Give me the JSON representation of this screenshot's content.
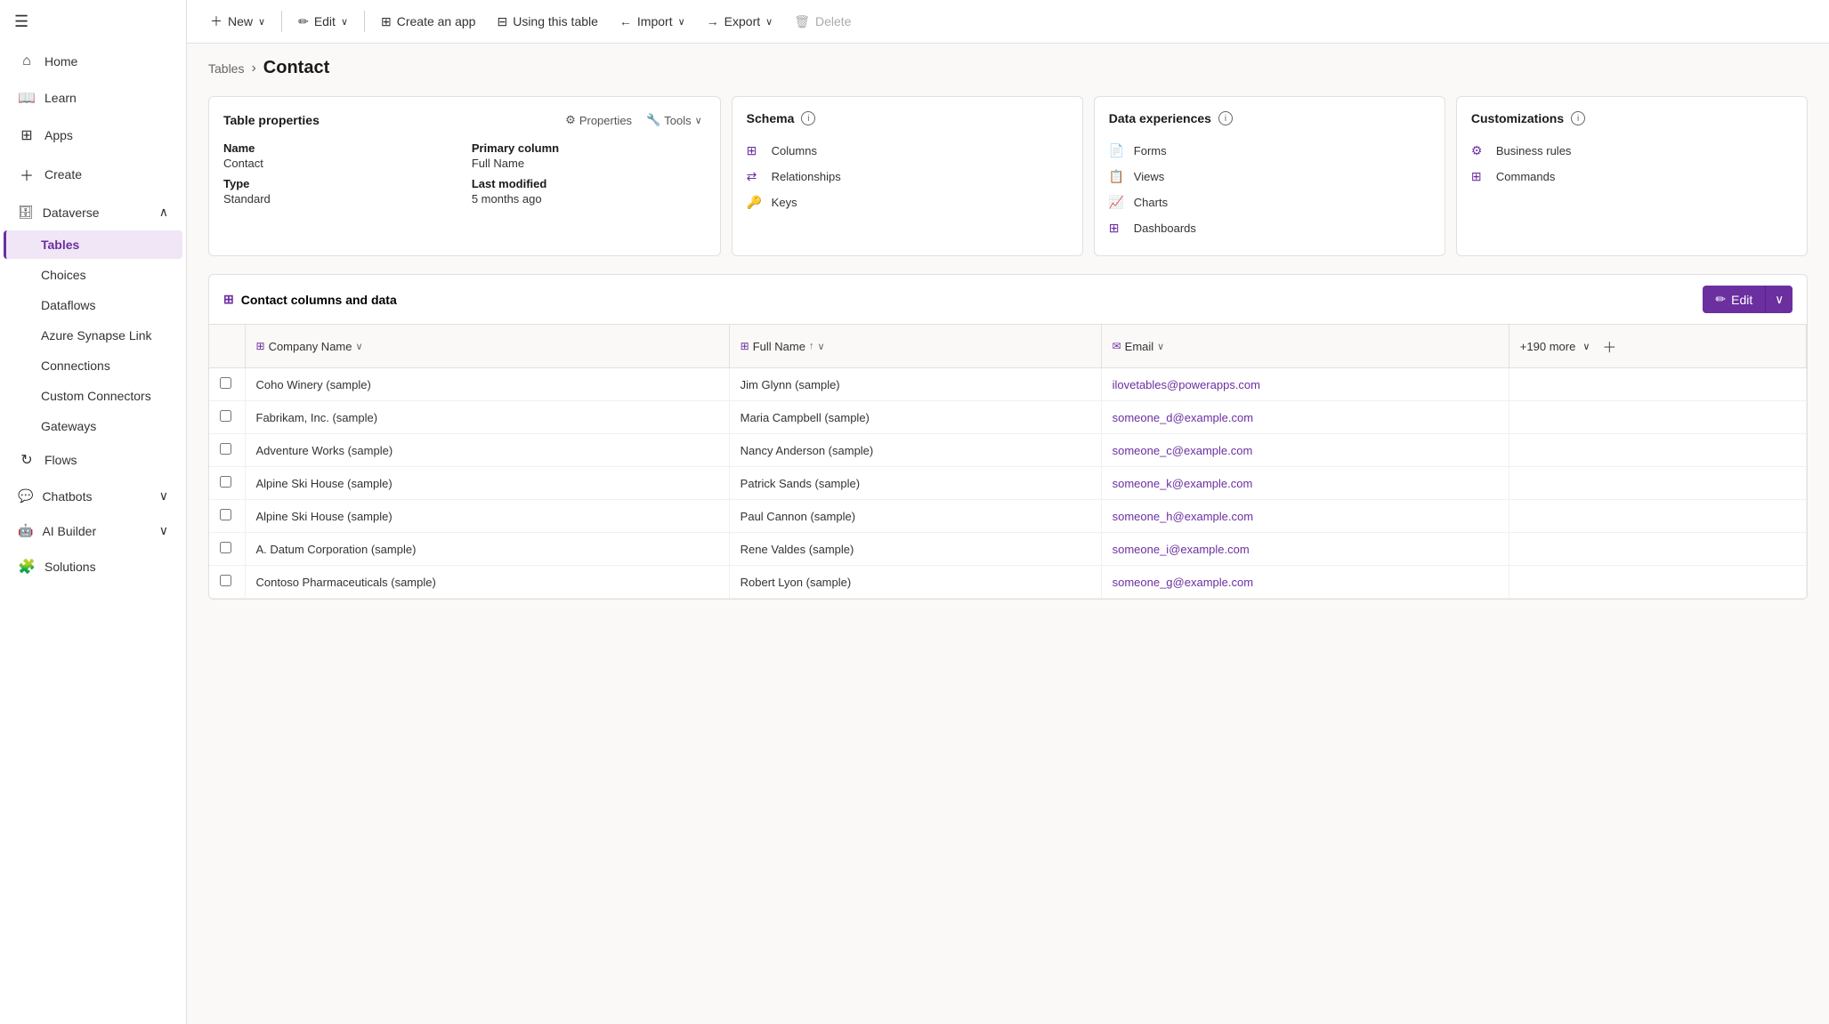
{
  "sidebar": {
    "hamburger_icon": "☰",
    "items": [
      {
        "id": "home",
        "label": "Home",
        "icon": "⌂",
        "active": false
      },
      {
        "id": "learn",
        "label": "Learn",
        "icon": "📖",
        "active": false
      },
      {
        "id": "apps",
        "label": "Apps",
        "icon": "⊞",
        "active": false
      },
      {
        "id": "create",
        "label": "Create",
        "icon": "＋",
        "active": false
      },
      {
        "id": "dataverse",
        "label": "Dataverse",
        "icon": "🗄",
        "active": true,
        "expandable": true,
        "expanded": true
      }
    ],
    "dataverse_children": [
      {
        "id": "tables",
        "label": "Tables",
        "active": true
      },
      {
        "id": "choices",
        "label": "Choices",
        "active": false
      },
      {
        "id": "dataflows",
        "label": "Dataflows",
        "active": false
      },
      {
        "id": "azure-synapse",
        "label": "Azure Synapse Link",
        "active": false
      },
      {
        "id": "connections",
        "label": "Connections",
        "active": false
      },
      {
        "id": "custom-connectors",
        "label": "Custom Connectors",
        "active": false
      },
      {
        "id": "gateways",
        "label": "Gateways",
        "active": false
      }
    ],
    "bottom_items": [
      {
        "id": "flows",
        "label": "Flows",
        "icon": "↻",
        "expandable": false
      },
      {
        "id": "chatbots",
        "label": "Chatbots",
        "icon": "💬",
        "expandable": true
      },
      {
        "id": "ai-builder",
        "label": "AI Builder",
        "icon": "🤖",
        "expandable": true
      },
      {
        "id": "solutions",
        "label": "Solutions",
        "icon": "🧩",
        "expandable": false
      }
    ]
  },
  "toolbar": {
    "new_label": "New",
    "edit_label": "Edit",
    "create_app_label": "Create an app",
    "using_table_label": "Using this table",
    "import_label": "Import",
    "export_label": "Export",
    "delete_label": "Delete"
  },
  "breadcrumb": {
    "parent": "Tables",
    "current": "Contact"
  },
  "table_properties_card": {
    "title": "Table properties",
    "properties_btn": "Properties",
    "tools_btn": "Tools",
    "name_label": "Name",
    "name_value": "Contact",
    "type_label": "Type",
    "type_value": "Standard",
    "primary_column_label": "Primary column",
    "primary_column_value": "Full Name",
    "last_modified_label": "Last modified",
    "last_modified_value": "5 months ago"
  },
  "schema_card": {
    "title": "Schema",
    "items": [
      {
        "id": "columns",
        "label": "Columns",
        "icon": "⊞"
      },
      {
        "id": "relationships",
        "label": "Relationships",
        "icon": "⇄"
      },
      {
        "id": "keys",
        "label": "Keys",
        "icon": "🔑"
      }
    ]
  },
  "data_experiences_card": {
    "title": "Data experiences",
    "items": [
      {
        "id": "forms",
        "label": "Forms",
        "icon": "📄"
      },
      {
        "id": "views",
        "label": "Views",
        "icon": "📋"
      },
      {
        "id": "charts",
        "label": "Charts",
        "icon": "📈"
      },
      {
        "id": "dashboards",
        "label": "Dashboards",
        "icon": "⊞"
      }
    ]
  },
  "customizations_card": {
    "title": "Customizations",
    "items": [
      {
        "id": "business-rules",
        "label": "Business rules",
        "icon": "⚙"
      },
      {
        "id": "commands",
        "label": "Commands",
        "icon": "⊞"
      }
    ]
  },
  "contact_table": {
    "title": "Contact columns and data",
    "edit_label": "Edit",
    "columns": [
      {
        "id": "company-name",
        "label": "Company Name",
        "icon": "⊞",
        "sortable": true
      },
      {
        "id": "full-name",
        "label": "Full Name",
        "icon": "⊞",
        "sortable": true,
        "sorted": true
      },
      {
        "id": "email",
        "label": "Email",
        "icon": "✉",
        "sortable": true
      }
    ],
    "more_cols_label": "+190 more",
    "rows": [
      {
        "company": "Coho Winery (sample)",
        "full_name": "Jim Glynn (sample)",
        "email": "ilovetables@powerapps.com"
      },
      {
        "company": "Fabrikam, Inc. (sample)",
        "full_name": "Maria Campbell (sample)",
        "email": "someone_d@example.com"
      },
      {
        "company": "Adventure Works (sample)",
        "full_name": "Nancy Anderson (sample)",
        "email": "someone_c@example.com"
      },
      {
        "company": "Alpine Ski House (sample)",
        "full_name": "Patrick Sands (sample)",
        "email": "someone_k@example.com"
      },
      {
        "company": "Alpine Ski House (sample)",
        "full_name": "Paul Cannon (sample)",
        "email": "someone_h@example.com"
      },
      {
        "company": "A. Datum Corporation (sample)",
        "full_name": "Rene Valdes (sample)",
        "email": "someone_i@example.com"
      },
      {
        "company": "Contoso Pharmaceuticals (sample)",
        "full_name": "Robert Lyon (sample)",
        "email": "someone_g@example.com"
      }
    ]
  }
}
